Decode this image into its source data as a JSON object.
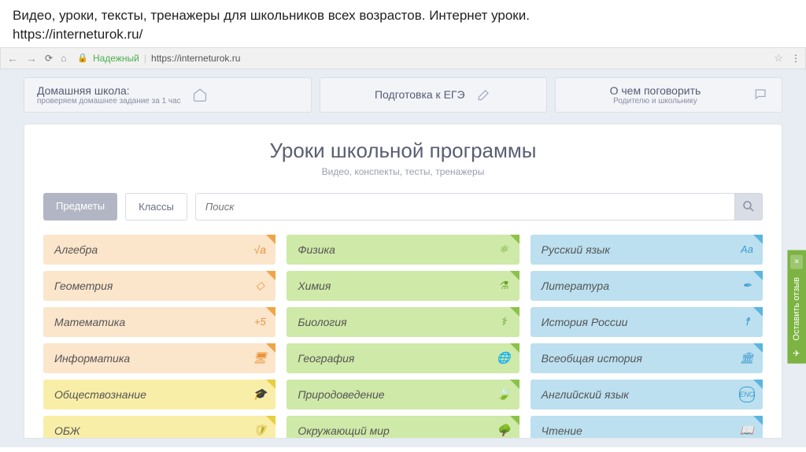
{
  "slide": {
    "line1": "Видео, уроки, тексты, тренажеры для школьников всех возрастов. Интернет уроки.",
    "line2": "https://interneturok.ru/"
  },
  "browser": {
    "reliable_label": "Надежный",
    "url": "https://interneturok.ru"
  },
  "banners": [
    {
      "title": "Домашняя школа:",
      "subtitle": "проверяем домашнее задание за 1 час"
    },
    {
      "title": "Подготовка к ЕГЭ",
      "subtitle": ""
    },
    {
      "title": "О чем поговорить",
      "subtitle": "Родителю и школьнику"
    }
  ],
  "page": {
    "title": "Уроки школьной программы",
    "subtitle": "Видео, конспекты, тесты, тренажеры"
  },
  "tabs": {
    "subjects": "Предметы",
    "classes": "Классы"
  },
  "search": {
    "placeholder": "Поиск"
  },
  "subjects": {
    "col0": [
      {
        "label": "Алгебра",
        "color": "orange",
        "icon": "sqrt-icon"
      },
      {
        "label": "Геометрия",
        "color": "orange",
        "icon": "shapes-icon"
      },
      {
        "label": "Математика",
        "color": "orange",
        "icon": "plus5-icon"
      },
      {
        "label": "Информатика",
        "color": "orange",
        "icon": "monitor-icon"
      },
      {
        "label": "Обществознание",
        "color": "yellow",
        "icon": "gradcap-icon"
      },
      {
        "label": "ОБЖ",
        "color": "yellow",
        "icon": "shield-icon"
      }
    ],
    "col1": [
      {
        "label": "Физика",
        "color": "green",
        "icon": "atom-icon"
      },
      {
        "label": "Химия",
        "color": "green",
        "icon": "flask-icon"
      },
      {
        "label": "Биология",
        "color": "green",
        "icon": "dna-icon"
      },
      {
        "label": "География",
        "color": "green",
        "icon": "globe-icon"
      },
      {
        "label": "Природоведение",
        "color": "green",
        "icon": "leaf-icon"
      },
      {
        "label": "Окружающий мир",
        "color": "green",
        "icon": "tree-icon"
      }
    ],
    "col2": [
      {
        "label": "Русский язык",
        "color": "blue",
        "icon": "letters-icon"
      },
      {
        "label": "Литература",
        "color": "blue",
        "icon": "quill-icon"
      },
      {
        "label": "История России",
        "color": "blue",
        "icon": "church-icon"
      },
      {
        "label": "Всеобщая история",
        "color": "blue",
        "icon": "columns-icon"
      },
      {
        "label": "Английский язык",
        "color": "blue",
        "icon": "eng-icon"
      },
      {
        "label": "Чтение",
        "color": "blue",
        "icon": "book-icon"
      }
    ]
  },
  "feedback": {
    "label": "Оставить отзыв",
    "close": "×"
  }
}
